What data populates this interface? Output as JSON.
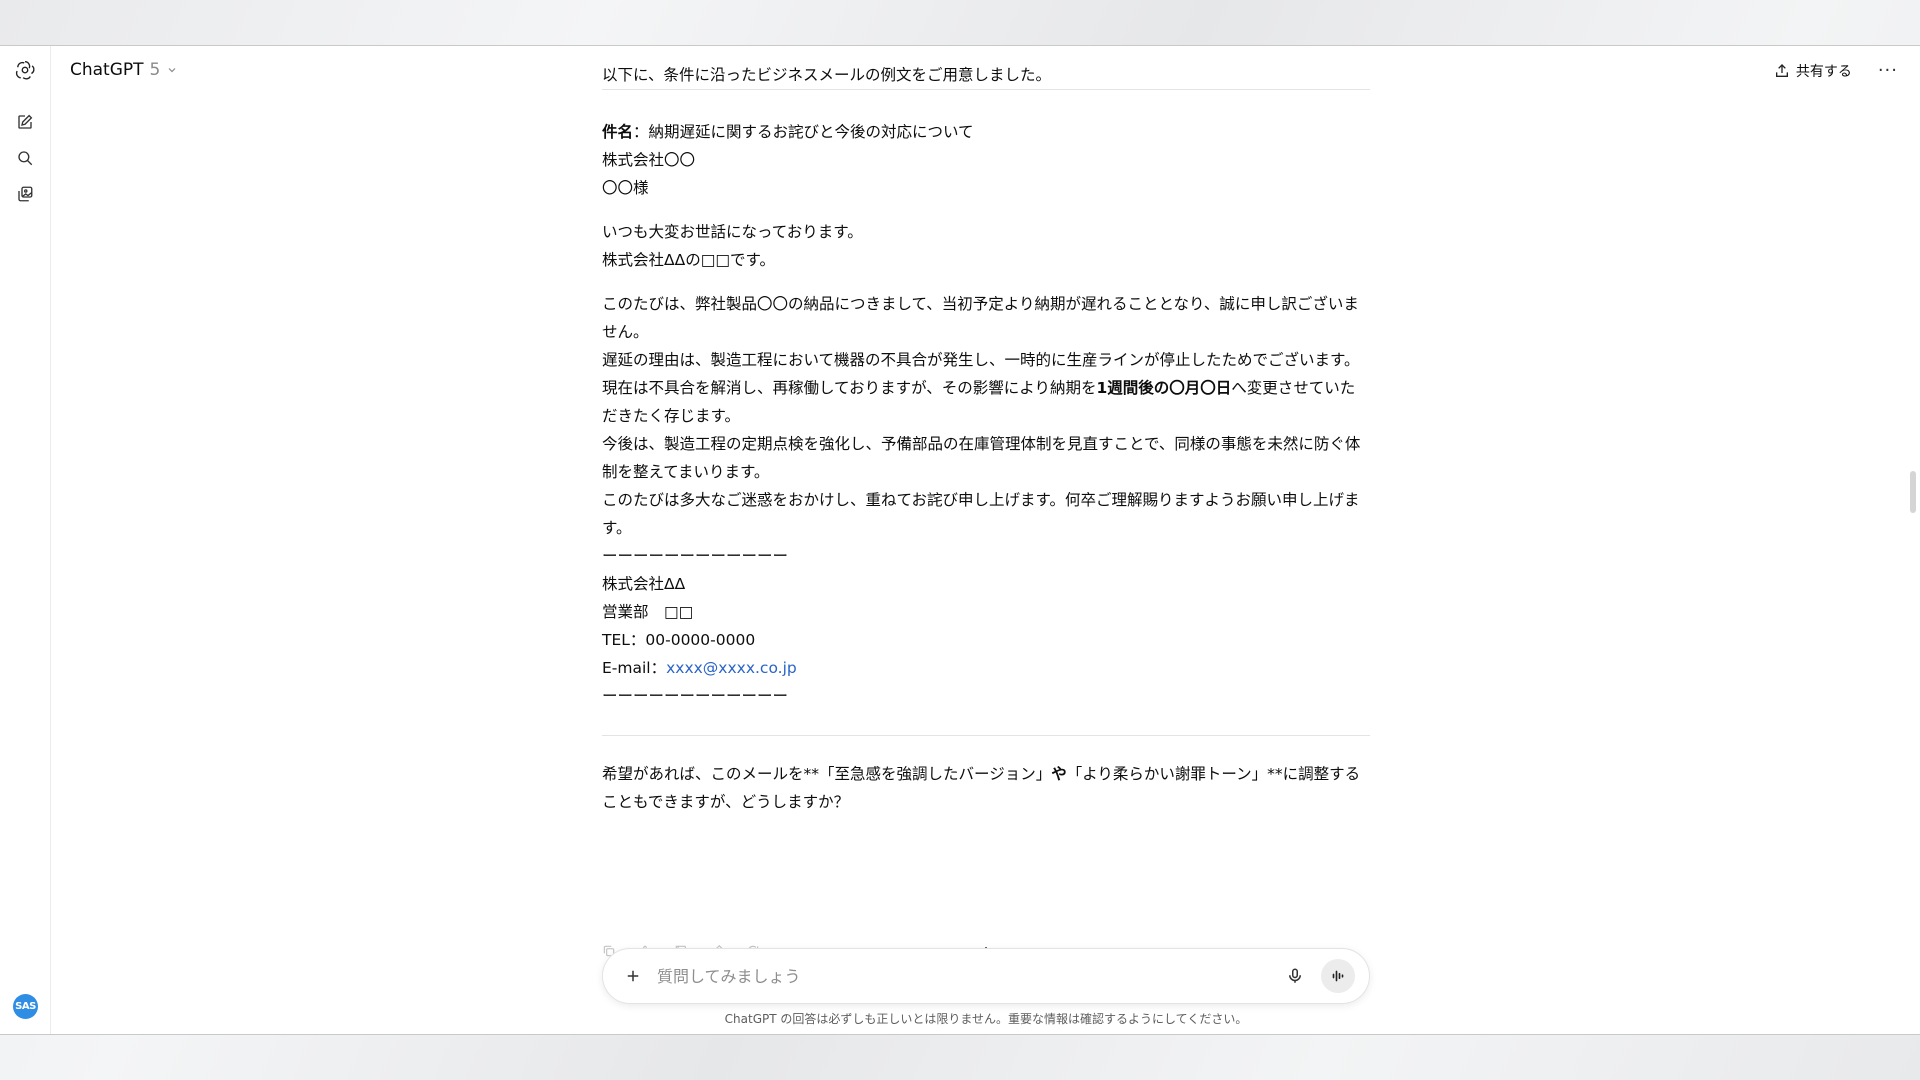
{
  "header": {
    "model_name": "ChatGPT",
    "model_version": "5",
    "share_label": "共有する",
    "more_label": "···"
  },
  "sidebar": {
    "avatar_initials": "SAS"
  },
  "message": {
    "intro": "以下に、条件に沿ったビジネスメールの例文をご用意しました。",
    "subject_label": "件名",
    "subject_text": "：納期遅延に関するお詫びと今後の対応について",
    "recipient_company": "株式会社〇〇",
    "recipient_name": "〇〇様",
    "greeting_1": "いつも大変お世話になっております。",
    "greeting_2": "株式会社ΔΔの□□です。",
    "para_apology": "このたびは、弊社製品〇〇の納品につきまして、当初予定より納期が遅れることとなり、誠に申し訳ございません。",
    "para_reason_a": "遅延の理由は、製造工程において機器の不具合が発生し、一時的に生産ラインが停止したためでございます。現在は不具合を解消し、再稼働しておりますが、その影響により納期を",
    "para_reason_bold": "1週間後の〇月〇日",
    "para_reason_b": "へ変更させていただきたく存じます。",
    "para_prevention": "今後は、製造工程の定期点検を強化し、予備部品の在庫管理体制を見直すことで、同様の事態を未然に防ぐ体制を整えてまいります。",
    "para_closing": "このたびは多大なご迷惑をおかけし、重ねてお詫び申し上げます。何卒ご理解賜りますようお願い申し上げます。",
    "sig_divider": "ーーーーーーーーーーーー",
    "sig_company": "株式会社ΔΔ",
    "sig_dept": "営業部　□□",
    "sig_tel": "TEL：00-0000-0000",
    "sig_email_label": "E-mail：",
    "sig_email": "xxxx@xxxx.co.jp",
    "followup_a": "希望があれば、このメールを**「至急感を強調したバージョン」",
    "followup_bold": "や",
    "followup_b": "「より柔らかい謝罪トーン」**に調整することもできますが、どうしますか？"
  },
  "composer": {
    "placeholder": "質問してみましょう"
  },
  "footer": {
    "disclaimer": "ChatGPT の回答は必ずしも正しいとは限りません。重要な情報は確認するようにしてください。"
  },
  "icons": {
    "logo": "openai-logo-icon",
    "new_chat": "new-chat-icon",
    "search": "search-icon",
    "library": "library-icon",
    "share": "share-icon",
    "mic": "mic-icon",
    "voice": "voice-mode-icon",
    "plus": "plus-icon",
    "down": "arrow-down-icon"
  },
  "colors": {
    "link": "#2a64c9",
    "avatar": "#2f8de4"
  }
}
